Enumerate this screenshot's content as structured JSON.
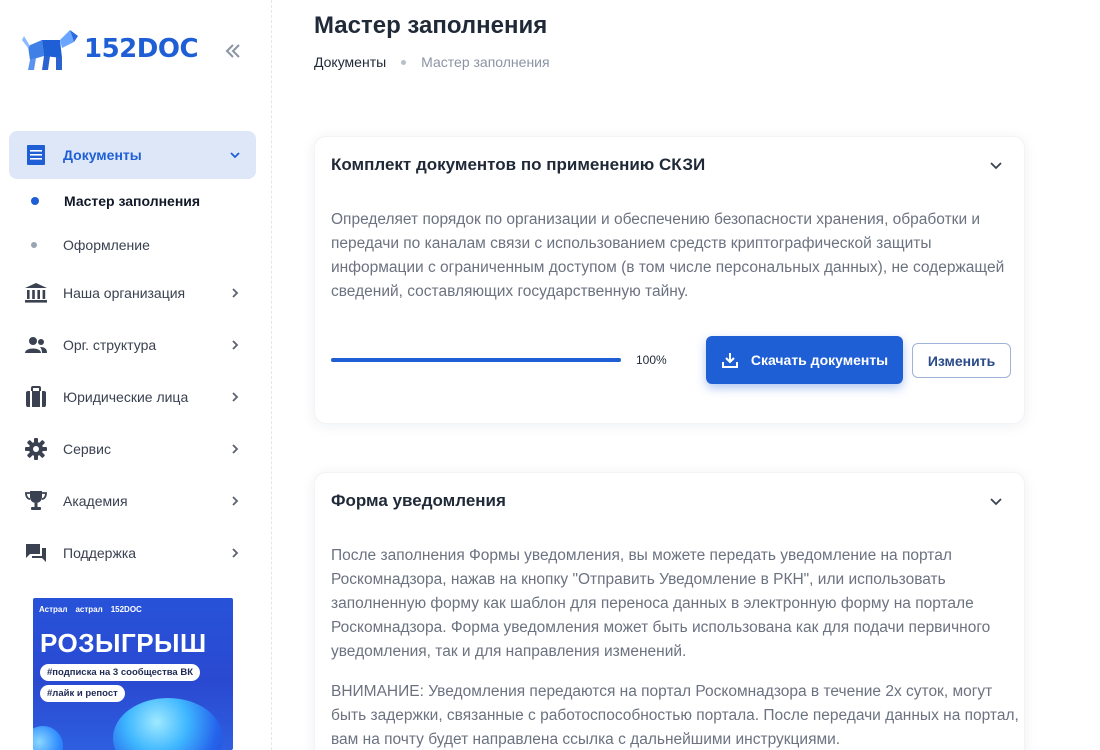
{
  "brand": {
    "name": "152DOC",
    "color": "#1f5fd6"
  },
  "page": {
    "title": "Мастер заполнения",
    "breadcrumb": [
      "Документы",
      "Мастер заполнения"
    ]
  },
  "sidebar": {
    "items": [
      {
        "label": "Документы",
        "icon": "document-list-icon",
        "active": true,
        "expanded": true,
        "children": [
          {
            "label": "Мастер заполнения",
            "active": true
          },
          {
            "label": "Оформление",
            "active": false
          }
        ]
      },
      {
        "label": "Наша организация",
        "icon": "bank-icon"
      },
      {
        "label": "Орг. структура",
        "icon": "people-icon"
      },
      {
        "label": "Юридические лица",
        "icon": "briefcase-icon"
      },
      {
        "label": "Сервис",
        "icon": "gear-icon"
      },
      {
        "label": "Академия",
        "icon": "trophy-icon"
      },
      {
        "label": "Поддержка",
        "icon": "chat-icon"
      }
    ]
  },
  "promo": {
    "partners": [
      "Астрал",
      "астрал",
      "152DOC"
    ],
    "title": "РОЗЫГРЫШ",
    "tags": [
      "#подписка на 3 сообщества ВК",
      "#лайк и репост"
    ]
  },
  "cards": [
    {
      "title": "Комплект документов по применению СКЗИ",
      "paragraphs": [
        "Определяет порядок по организации и обеспечению безопасности хранения, обработки и передачи по каналам связи с использованием средств криптографической защиты информации с ограниченным доступом (в том числе персональных данных), не содержащей сведений, составляющих государственную тайну."
      ],
      "progress": 100,
      "progress_label": "100%",
      "download_label": "Скачать документы",
      "edit_label": "Изменить"
    },
    {
      "title": "Форма уведомления",
      "paragraphs": [
        "После заполнения Формы уведомления, вы можете передать уведомление на портал Роскомнадзора, нажав на кнопку \"Отправить Уведомление в РКН\", или использовать заполненную форму как шаблон для переноса данных в электронную форму на портале Роскомнадзора. Форма уведомления может быть использована как для подачи первичного уведомления, так и для направления изменений.",
        "ВНИМАНИЕ: Уведомления передаются на портал Роскомнадзора в течение 2х суток, могут быть задержки, связанные с работоспособностью портала. После передачи данных на портал, вам на почту будет направлена ссылка с дальнейшими инструкциями."
      ]
    }
  ]
}
